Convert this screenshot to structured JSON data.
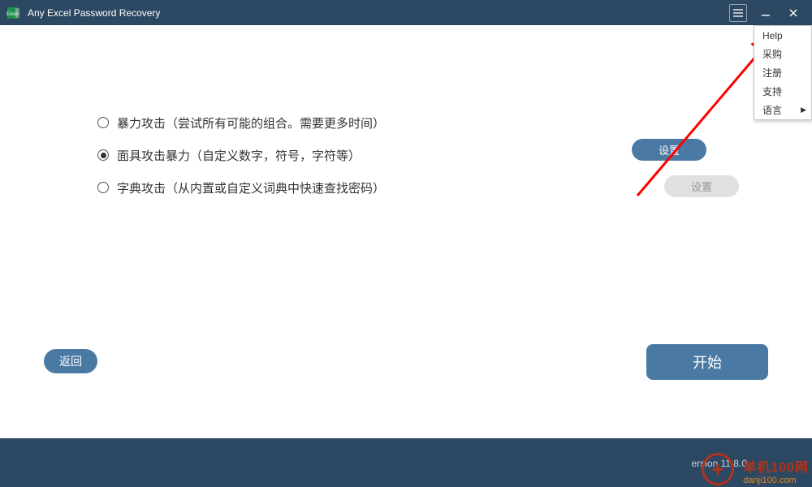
{
  "app": {
    "title": "Any Excel Password Recovery"
  },
  "options": [
    {
      "label": "暴力攻击（尝试所有可能的组合。需要更多时间）",
      "selected": false
    },
    {
      "label": "面具攻击暴力（自定义数字，符号，字符等）",
      "selected": true
    },
    {
      "label": "字典攻击（从内置或自定义词典中快速查找密码）",
      "selected": false
    }
  ],
  "side_buttons": {
    "settings_active": "设置",
    "settings_disabled": "设置"
  },
  "actions": {
    "back": "返回",
    "start": "开始"
  },
  "footer": {
    "version_prefix": "ersion ",
    "version": "11.8.0"
  },
  "menu": {
    "items": [
      {
        "label": "Help",
        "submenu": false
      },
      {
        "label": "采购",
        "submenu": false
      },
      {
        "label": "注册",
        "submenu": false
      },
      {
        "label": "支持",
        "submenu": false
      },
      {
        "label": "语言",
        "submenu": true
      }
    ]
  },
  "watermark": {
    "ring": "+",
    "line1": "单机100网",
    "line2": "danji100.com"
  },
  "colors": {
    "bar": "#2d4862",
    "primary": "#4a7aa3",
    "arrow": "#ff0000"
  }
}
